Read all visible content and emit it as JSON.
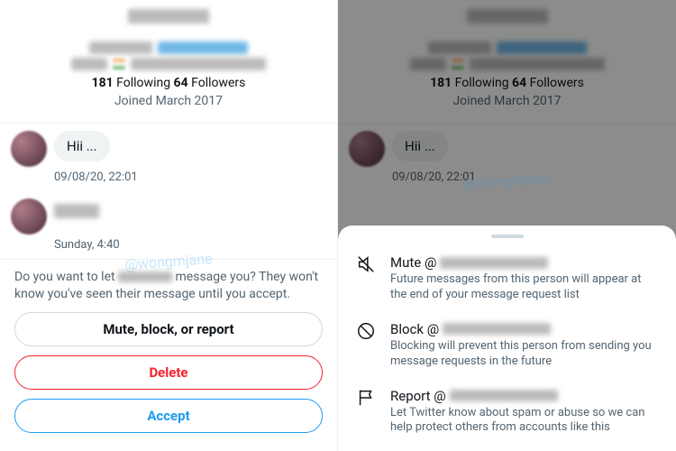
{
  "profile": {
    "following_count": "181",
    "following_label": "Following",
    "followers_count": "64",
    "followers_label": "Followers",
    "joined": "Joined March 2017"
  },
  "messages": [
    {
      "text": "Hii ...",
      "timestamp": "09/08/20, 22:01"
    },
    {
      "text": "",
      "timestamp": "Sunday, 4:40"
    }
  ],
  "prompt": {
    "pre": "Do you want to let ",
    "post_a": " message you? They won't",
    "post_b": "know you've seen their message until you accept."
  },
  "buttons": {
    "mute_block_report": "Mute, block, or report",
    "delete": "Delete",
    "accept": "Accept"
  },
  "watermark": "@wongmjane",
  "sheet": {
    "mute": {
      "title": "Mute @",
      "sub": "Future messages from this person will appear at the end of your message request list"
    },
    "block": {
      "title": "Block @",
      "sub": "Blocking will prevent this person from sending you message requests in the future"
    },
    "report": {
      "title": "Report @",
      "sub": "Let Twitter know about spam or abuse so we can help protect others from accounts like this"
    }
  }
}
